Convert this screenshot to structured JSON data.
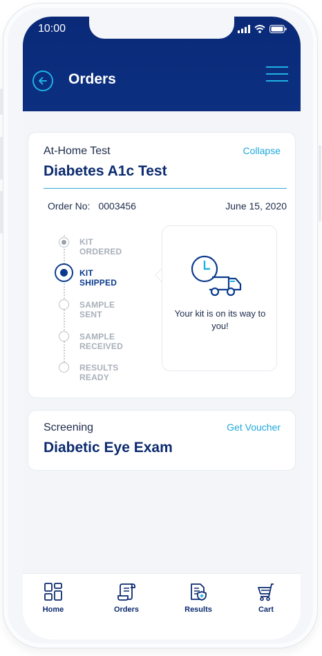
{
  "status_bar": {
    "time": "10:00"
  },
  "header": {
    "title": "Orders"
  },
  "order_card": {
    "category": "At-Home Test",
    "title": "Diabetes A1c Test",
    "action": "Collapse",
    "order_no_label": "Order No:",
    "order_no": "0003456",
    "date": "June 15, 2020",
    "steps": [
      {
        "label": "KIT ORDERED",
        "state": "done"
      },
      {
        "label": "KIT SHIPPED",
        "state": "active"
      },
      {
        "label": "SAMPLE SENT",
        "state": "pending"
      },
      {
        "label": "SAMPLE RECEIVED",
        "state": "pending"
      },
      {
        "label": "RESULTS READY",
        "state": "pending"
      }
    ],
    "info_icon": "delivery-truck-clock-icon",
    "info_text": "Your kit is on its way to you!"
  },
  "screening_card": {
    "category": "Screening",
    "title": "Diabetic Eye Exam",
    "action": "Get Voucher"
  },
  "nav": {
    "items": [
      {
        "label": "Home",
        "icon": "home-grid-icon"
      },
      {
        "label": "Orders",
        "icon": "orders-scroll-icon"
      },
      {
        "label": "Results",
        "icon": "results-document-icon"
      },
      {
        "label": "Cart",
        "icon": "cart-icon"
      }
    ]
  },
  "colors": {
    "header_bg": "#0a2a78",
    "accent": "#20a9dc",
    "primary_text": "#0b2a6f",
    "inactive_step": "#a9b0ba"
  }
}
